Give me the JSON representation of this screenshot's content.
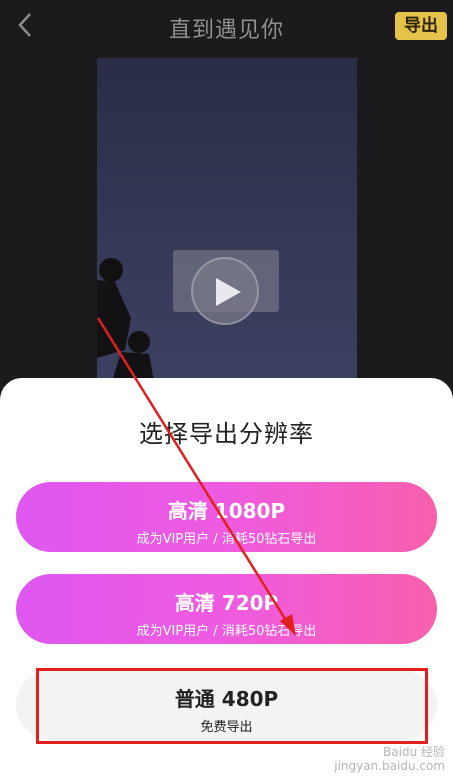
{
  "header": {
    "title": "直到遇见你",
    "export_label": "导出"
  },
  "sheet": {
    "title": "选择导出分辨率",
    "options": [
      {
        "name": "高清 1080P",
        "desc": "成为VIP用户 / 消耗50钻石导出"
      },
      {
        "name": "高清 720P",
        "desc": "成为VIP用户 / 消耗50钻石导出"
      },
      {
        "name": "普通 480P",
        "desc": "免费导出"
      }
    ]
  },
  "watermark": {
    "line1": "Baidu 经验",
    "line2": "jingyan.baidu.com"
  },
  "colors": {
    "accent_yellow": "#e5c24a",
    "option_gradient_start": "#df57f0",
    "option_gradient_end": "#f860ad",
    "annotation_red": "#e0201f"
  },
  "icons": {
    "back": "chevron-left-icon",
    "play": "play-icon"
  }
}
